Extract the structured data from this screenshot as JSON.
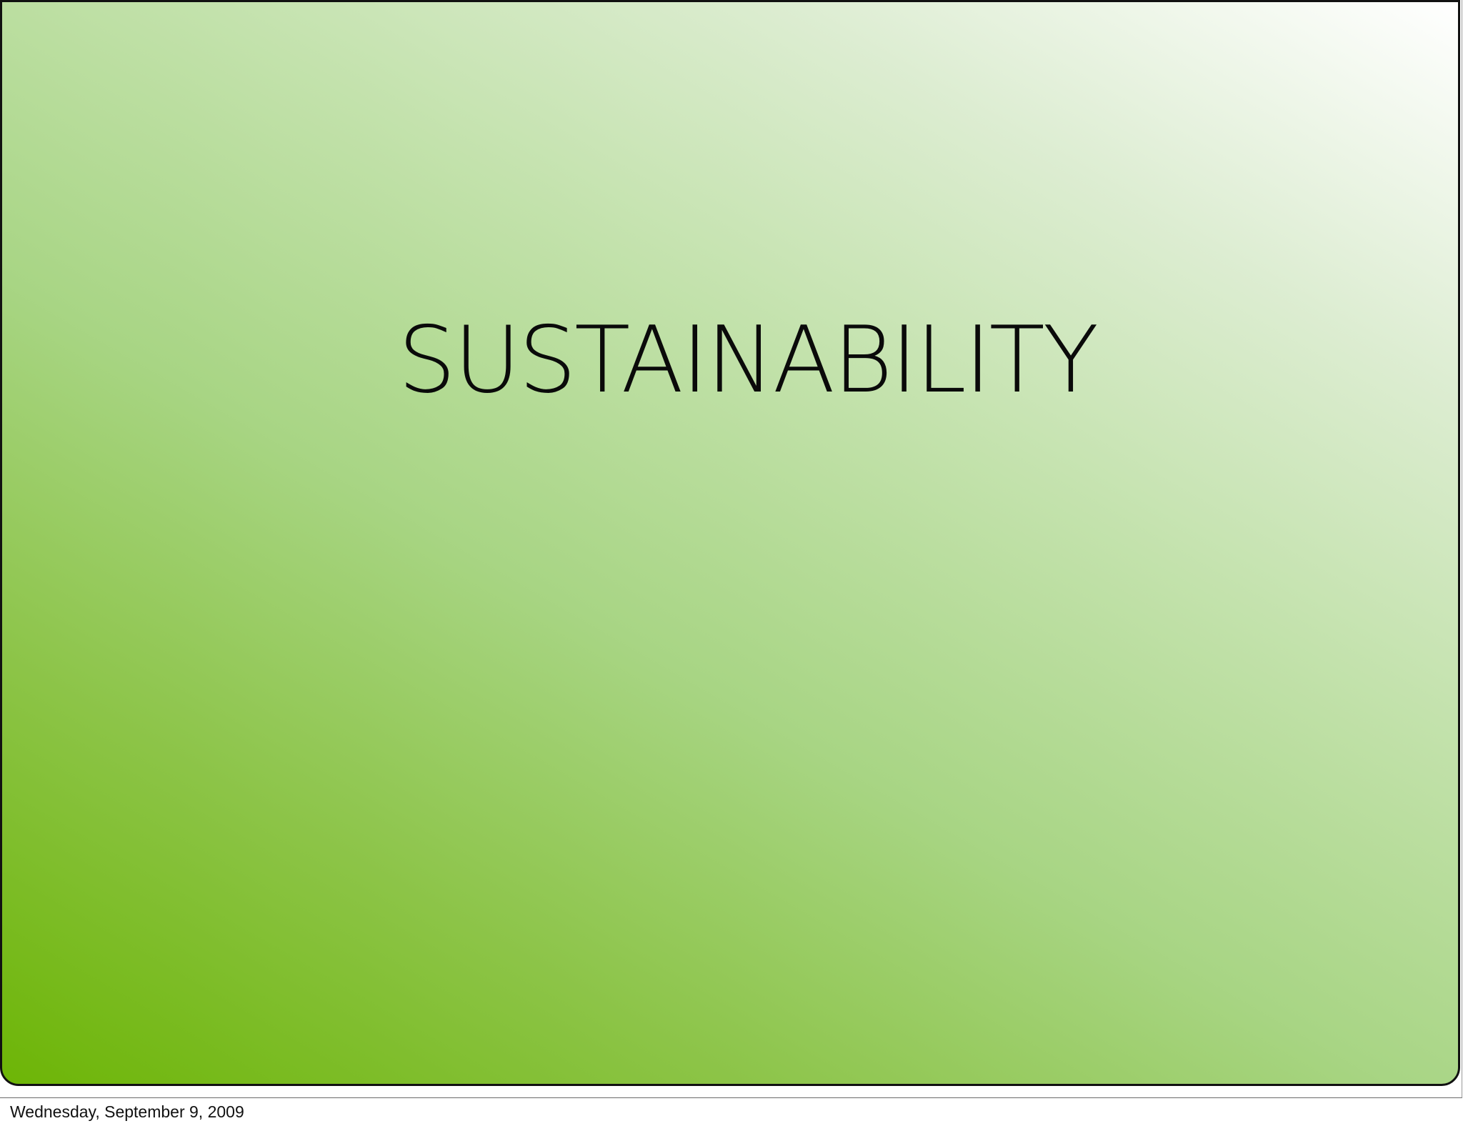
{
  "slide": {
    "title": "SUSTAINABILITY"
  },
  "footer": {
    "date": "Wednesday, September 9, 2009"
  },
  "colors": {
    "gradient_dark": "#6db506",
    "gradient_light": "#ffffff",
    "border": "#111111",
    "text": "#0a0a0a"
  }
}
